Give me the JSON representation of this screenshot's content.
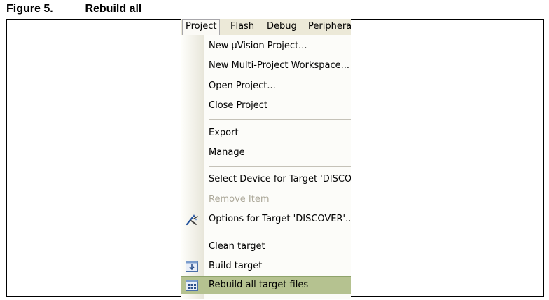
{
  "figure": {
    "number": "Figure 5.",
    "title": "Rebuild all"
  },
  "menubar": {
    "items": [
      "Project",
      "Flash",
      "Debug",
      "Periphera"
    ],
    "active": "Project"
  },
  "menu": {
    "items": [
      {
        "label": "New µVision Project...",
        "icon": null,
        "enabled": true
      },
      {
        "label": "New Multi-Project Workspace...",
        "icon": null,
        "enabled": true
      },
      {
        "label": "Open Project...",
        "icon": null,
        "enabled": true
      },
      {
        "label": "Close Project",
        "icon": null,
        "enabled": true
      },
      {
        "label": "Export",
        "icon": null,
        "enabled": true
      },
      {
        "label": "Manage",
        "icon": null,
        "enabled": true
      },
      {
        "label": "Select Device for Target 'DISCOV",
        "icon": null,
        "enabled": true
      },
      {
        "label": "Remove Item",
        "icon": null,
        "enabled": false
      },
      {
        "label": "Options for Target 'DISCOVER'...",
        "icon": "options-wand-icon",
        "enabled": true
      },
      {
        "label": "Clean target",
        "icon": null,
        "enabled": true
      },
      {
        "label": "Build target",
        "icon": "build-target-icon",
        "enabled": true
      },
      {
        "label": "Rebuild all target files",
        "icon": "rebuild-all-icon",
        "enabled": true,
        "selected": true
      }
    ]
  },
  "colors": {
    "menubar_bg": "#ece9d8",
    "menu_bg": "#fcfcf9",
    "highlight": "#b5c290",
    "disabled_text": "#aca899"
  }
}
